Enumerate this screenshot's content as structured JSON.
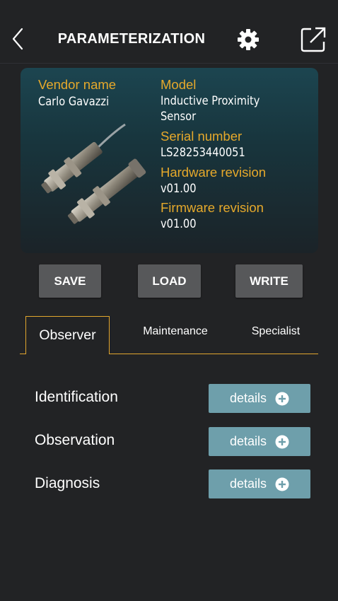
{
  "header": {
    "title": "PARAMETERIZATION",
    "back_icon": "chevron-left-icon",
    "settings_icon": "gear-icon",
    "export_icon": "external-link-icon"
  },
  "device": {
    "vendor_label": "Vendor name",
    "vendor_value": "Carlo Gavazzi",
    "model_label": "Model",
    "model_value": "Inductive Proximity Sensor",
    "serial_label": "Serial number",
    "serial_value": "LS28253440051",
    "hardware_label": "Hardware revision",
    "hardware_value": "v01.00",
    "firmware_label": "Firmware revision",
    "firmware_value": "v01.00"
  },
  "actions": {
    "save": "SAVE",
    "load": "LOAD",
    "write": "WRITE"
  },
  "tabs": {
    "observer": "Observer",
    "maintenance": "Maintenance",
    "specialist": "Specialist",
    "active": "observer"
  },
  "sections": [
    {
      "label": "Identification",
      "button": "details"
    },
    {
      "label": "Observation",
      "button": "details"
    },
    {
      "label": "Diagnosis",
      "button": "details"
    }
  ],
  "colors": {
    "background": "#222325",
    "accent": "#e6a92b",
    "button": "#57585a",
    "details_button": "#6e9fab"
  }
}
